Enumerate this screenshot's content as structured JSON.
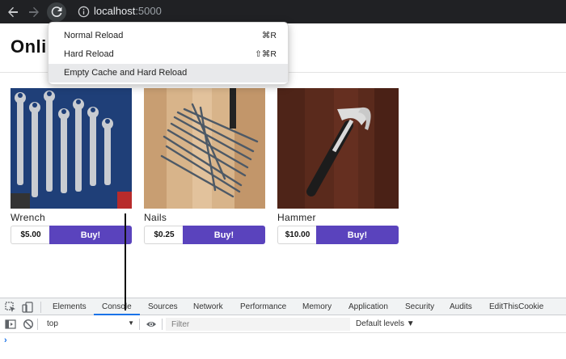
{
  "browser": {
    "url_host": "localhost",
    "url_port": ":5000"
  },
  "page": {
    "title": "Onli",
    "products": [
      {
        "name": "Wrench",
        "price": "$5.00",
        "buy_label": "Buy!"
      },
      {
        "name": "Nails",
        "price": "$0.25",
        "buy_label": "Buy!"
      },
      {
        "name": "Hammer",
        "price": "$10.00",
        "buy_label": "Buy!"
      }
    ]
  },
  "reload_menu": {
    "items": [
      {
        "label": "Normal Reload",
        "shortcut": "⌘R"
      },
      {
        "label": "Hard Reload",
        "shortcut": "⇧⌘R"
      },
      {
        "label": "Empty Cache and Hard Reload",
        "shortcut": ""
      }
    ]
  },
  "devtools": {
    "tabs": [
      "Elements",
      "Console",
      "Sources",
      "Network",
      "Performance",
      "Memory",
      "Application",
      "Security",
      "Audits",
      "EditThisCookie"
    ],
    "active_tab": "Console",
    "context": "top",
    "filter_placeholder": "Filter",
    "levels_label": "Default levels ▼",
    "prompt": "›"
  },
  "colors": {
    "buy_button": "#5a43bd",
    "toolbar": "#202124"
  }
}
